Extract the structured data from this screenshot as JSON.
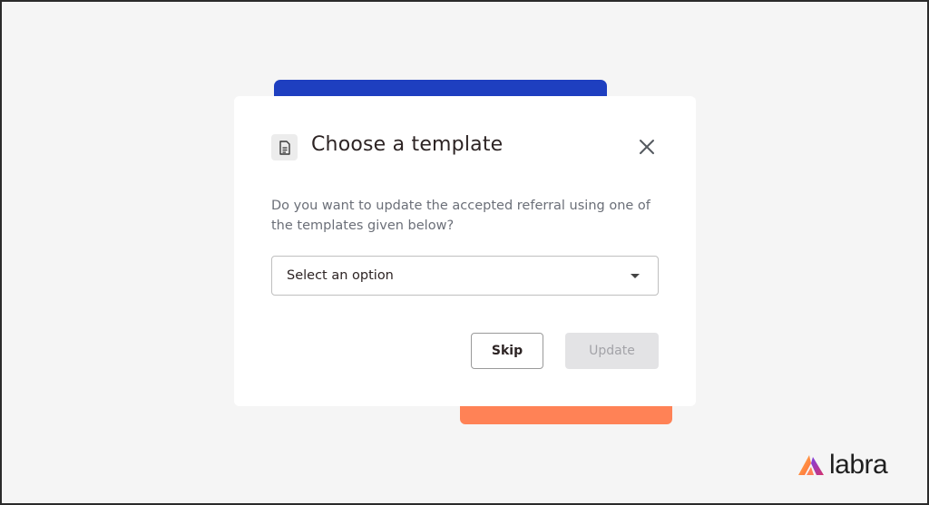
{
  "colors": {
    "background": "#f5f5f5",
    "accent_blue": "#1e3fc0",
    "accent_orange": "#ff8256",
    "dialog_bg": "#ffffff",
    "title_text": "#2d2424",
    "body_text": "#6b6f78",
    "disabled_button_bg": "#e3e3e5",
    "disabled_button_text": "#a3a3a8"
  },
  "dialog": {
    "title": "Choose a template",
    "title_icon": "document-icon",
    "close_icon": "close-icon",
    "description": "Do you want to update the accepted referral using one of the templates given below?",
    "select": {
      "placeholder": "Select an option",
      "value": "Select an option",
      "caret_icon": "caret-down-icon"
    },
    "buttons": {
      "skip_label": "Skip",
      "update_label": "Update",
      "update_disabled": true
    }
  },
  "brand": {
    "logo_icon": "labra-logo-icon",
    "name": "labra"
  }
}
